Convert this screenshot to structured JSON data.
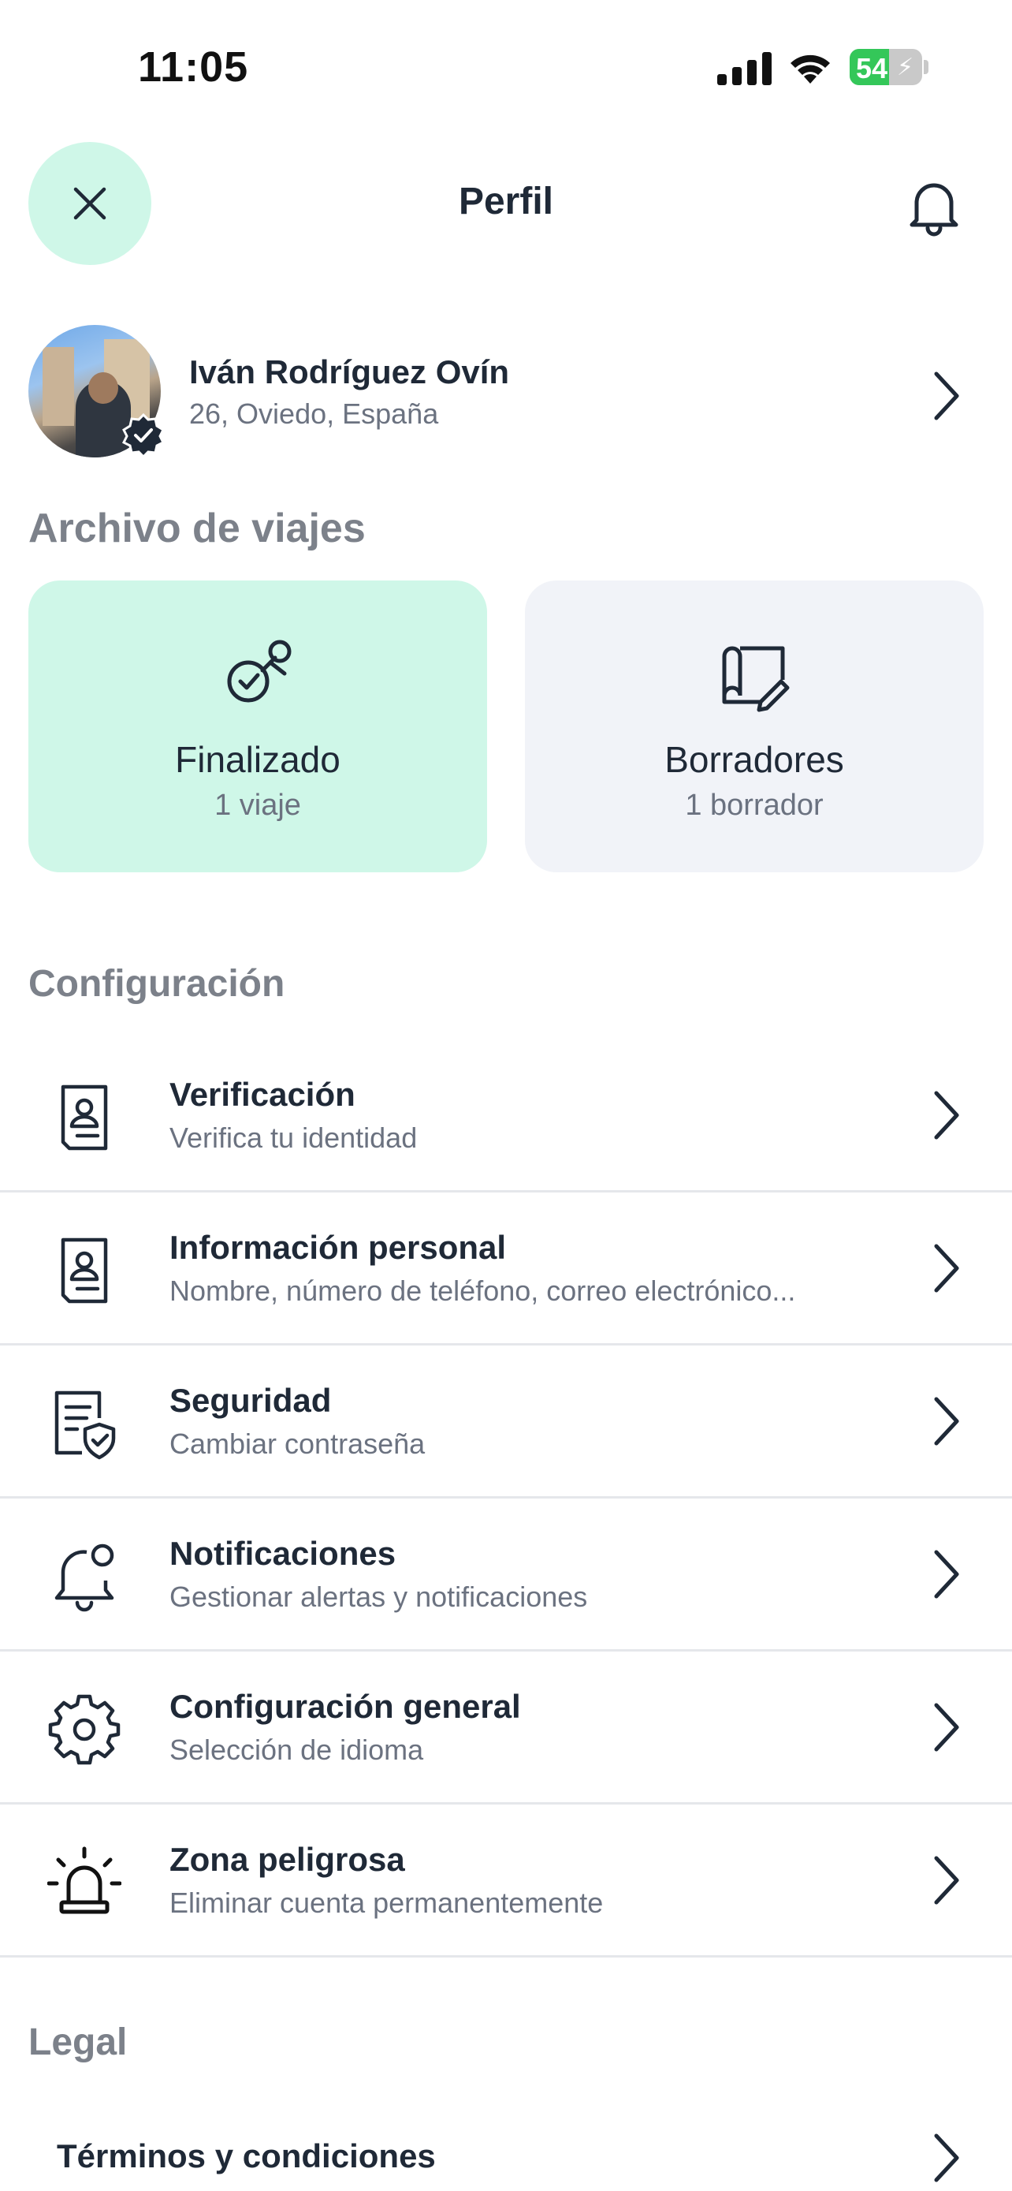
{
  "status_bar": {
    "time": "11:05",
    "battery_level": "54",
    "battery_fraction": 0.54
  },
  "header": {
    "title": "Perfil",
    "close_icon": "close-icon",
    "bell_icon": "bell-icon"
  },
  "profile": {
    "name": "Iván Rodríguez Ovín",
    "subtitle": "26, Oviedo, España"
  },
  "archive": {
    "section_title": "Archivo de viajes",
    "cards": [
      {
        "title": "Finalizado",
        "subtitle": "1 viaje",
        "icon": "pin-check-icon",
        "color": "#cff7e8"
      },
      {
        "title": "Borradores",
        "subtitle": "1 borrador",
        "icon": "map-edit-icon",
        "color": "#f1f3f8"
      }
    ]
  },
  "config": {
    "section_title": "Configuración",
    "items": [
      {
        "title": "Verificación",
        "subtitle": "Verifica tu identidad",
        "icon": "id-card-icon"
      },
      {
        "title": "Información personal",
        "subtitle": "Nombre, número de teléfono, correo electrónico...",
        "icon": "id-card-icon"
      },
      {
        "title": "Seguridad",
        "subtitle": "Cambiar contraseña",
        "icon": "shield-document-icon"
      },
      {
        "title": "Notificaciones",
        "subtitle": "Gestionar alertas y notificaciones",
        "icon": "bell-dot-icon"
      },
      {
        "title": "Configuración general",
        "subtitle": "Selección de idioma",
        "icon": "gear-icon"
      },
      {
        "title": "Zona peligrosa",
        "subtitle": "Eliminar cuenta permanentemente",
        "icon": "siren-icon"
      }
    ]
  },
  "legal": {
    "section_title": "Legal",
    "items": [
      {
        "title": "Términos y condiciones"
      }
    ]
  },
  "colors": {
    "accent_mint": "#cff7e8",
    "card_gray": "#f1f3f8",
    "text_dark": "#1f2937",
    "text_muted": "#6b7280",
    "section_gray": "#7c818a"
  }
}
